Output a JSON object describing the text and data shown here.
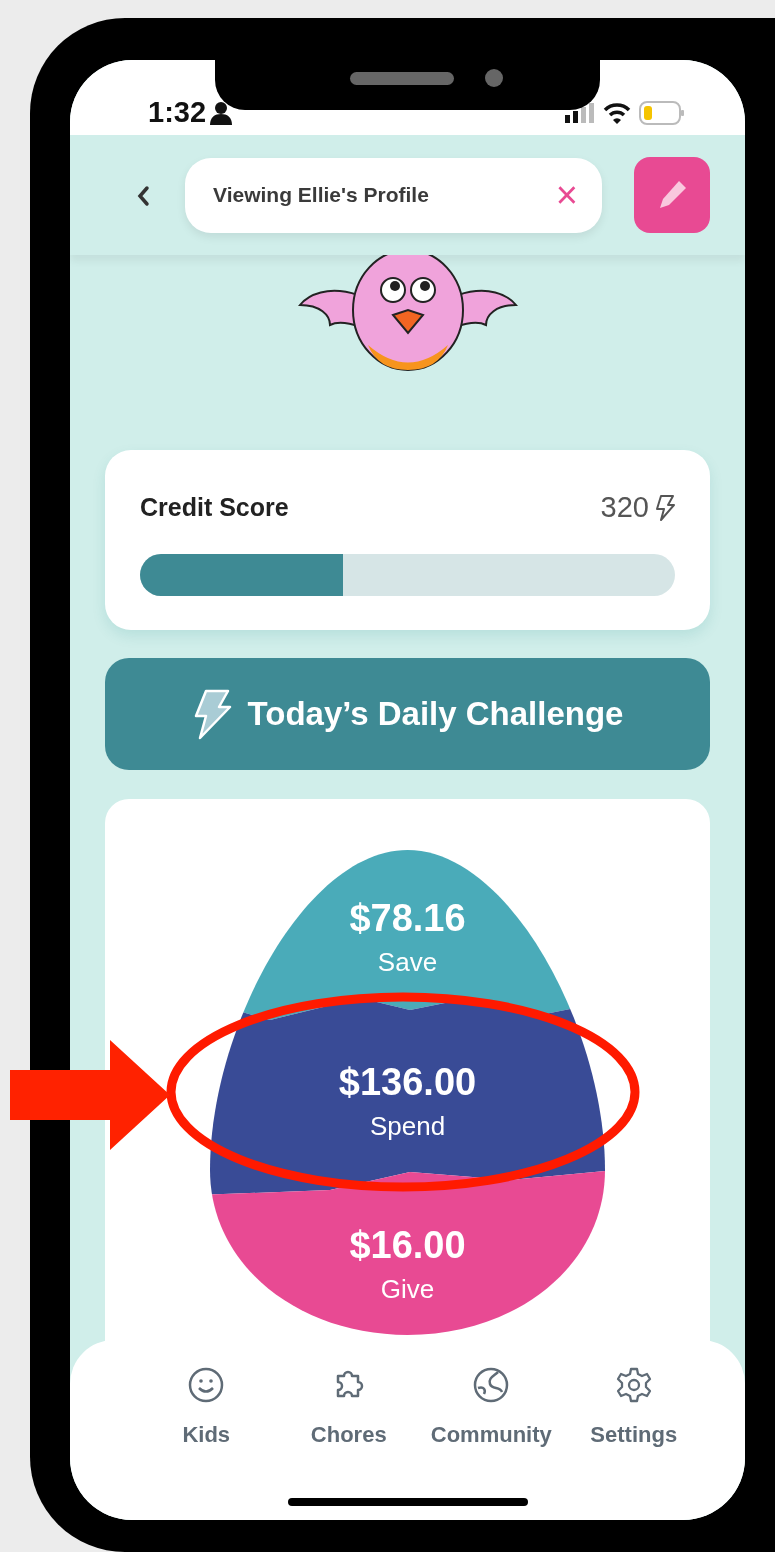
{
  "status_bar": {
    "time": "1:32"
  },
  "header": {
    "title": "Viewing Ellie's Profile",
    "close": "×"
  },
  "credit_score": {
    "label": "Credit Score",
    "value": "320",
    "level": 0.38
  },
  "challenge_button": {
    "label": "Today’s Daily Challenge"
  },
  "jars": [
    {
      "amount": "$78.16",
      "label": "Save",
      "color": "#4aabb9"
    },
    {
      "amount": "$136.00",
      "label": "Spend",
      "color": "#394b96"
    },
    {
      "amount": "$16.00",
      "label": "Give",
      "color": "#e84a93"
    }
  ],
  "tabs": [
    {
      "label": "Kids"
    },
    {
      "label": "Chores"
    },
    {
      "label": "Community"
    },
    {
      "label": "Settings"
    }
  ]
}
